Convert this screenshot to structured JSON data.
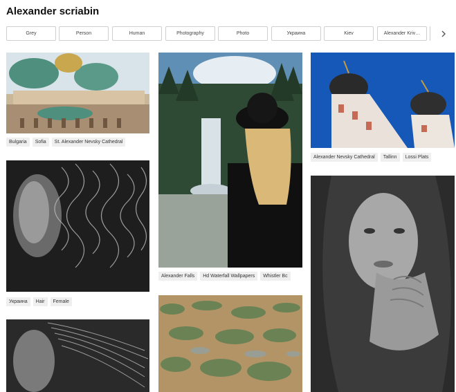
{
  "header": {
    "title": "Alexander scriabin"
  },
  "filters": [
    "Grey",
    "Person",
    "Human",
    "Photography",
    "Photo",
    "Украина",
    "Kiev",
    "Alexander Kriv…"
  ],
  "next_icon": "chevron-right-icon",
  "columns": [
    [
      {
        "name": "cathedral-photo",
        "alt": "Alexander Nevsky Cathedral domes",
        "tags": [
          "Bulgaria",
          "Sofia",
          "St. Alexander Nevsky Cathedral"
        ]
      },
      {
        "name": "curly-hair-portrait-photo",
        "alt": "Woman with curly hair",
        "tags": [
          "Украина",
          "Hair",
          "Female"
        ]
      },
      {
        "name": "profile-hair-photo",
        "alt": "Woman profile",
        "tags": []
      }
    ],
    [
      {
        "name": "waterfall-photo",
        "alt": "Woman at waterfall",
        "tags": [
          "Alexander Falls",
          "Hd Waterfall Wallpapers",
          "Whistler Bc"
        ]
      },
      {
        "name": "bog-aerial-photo",
        "alt": "Aerial bog landscape",
        "tags": []
      }
    ],
    [
      {
        "name": "tallinn-domes-photo",
        "alt": "Tallinn church domes",
        "tags": [
          "Alexander Nevsky Cathedral",
          "Tallinn",
          "Lossi Plats"
        ]
      },
      {
        "name": "hand-face-portrait-photo",
        "alt": "Woman with hand on chin",
        "tags": []
      }
    ]
  ]
}
